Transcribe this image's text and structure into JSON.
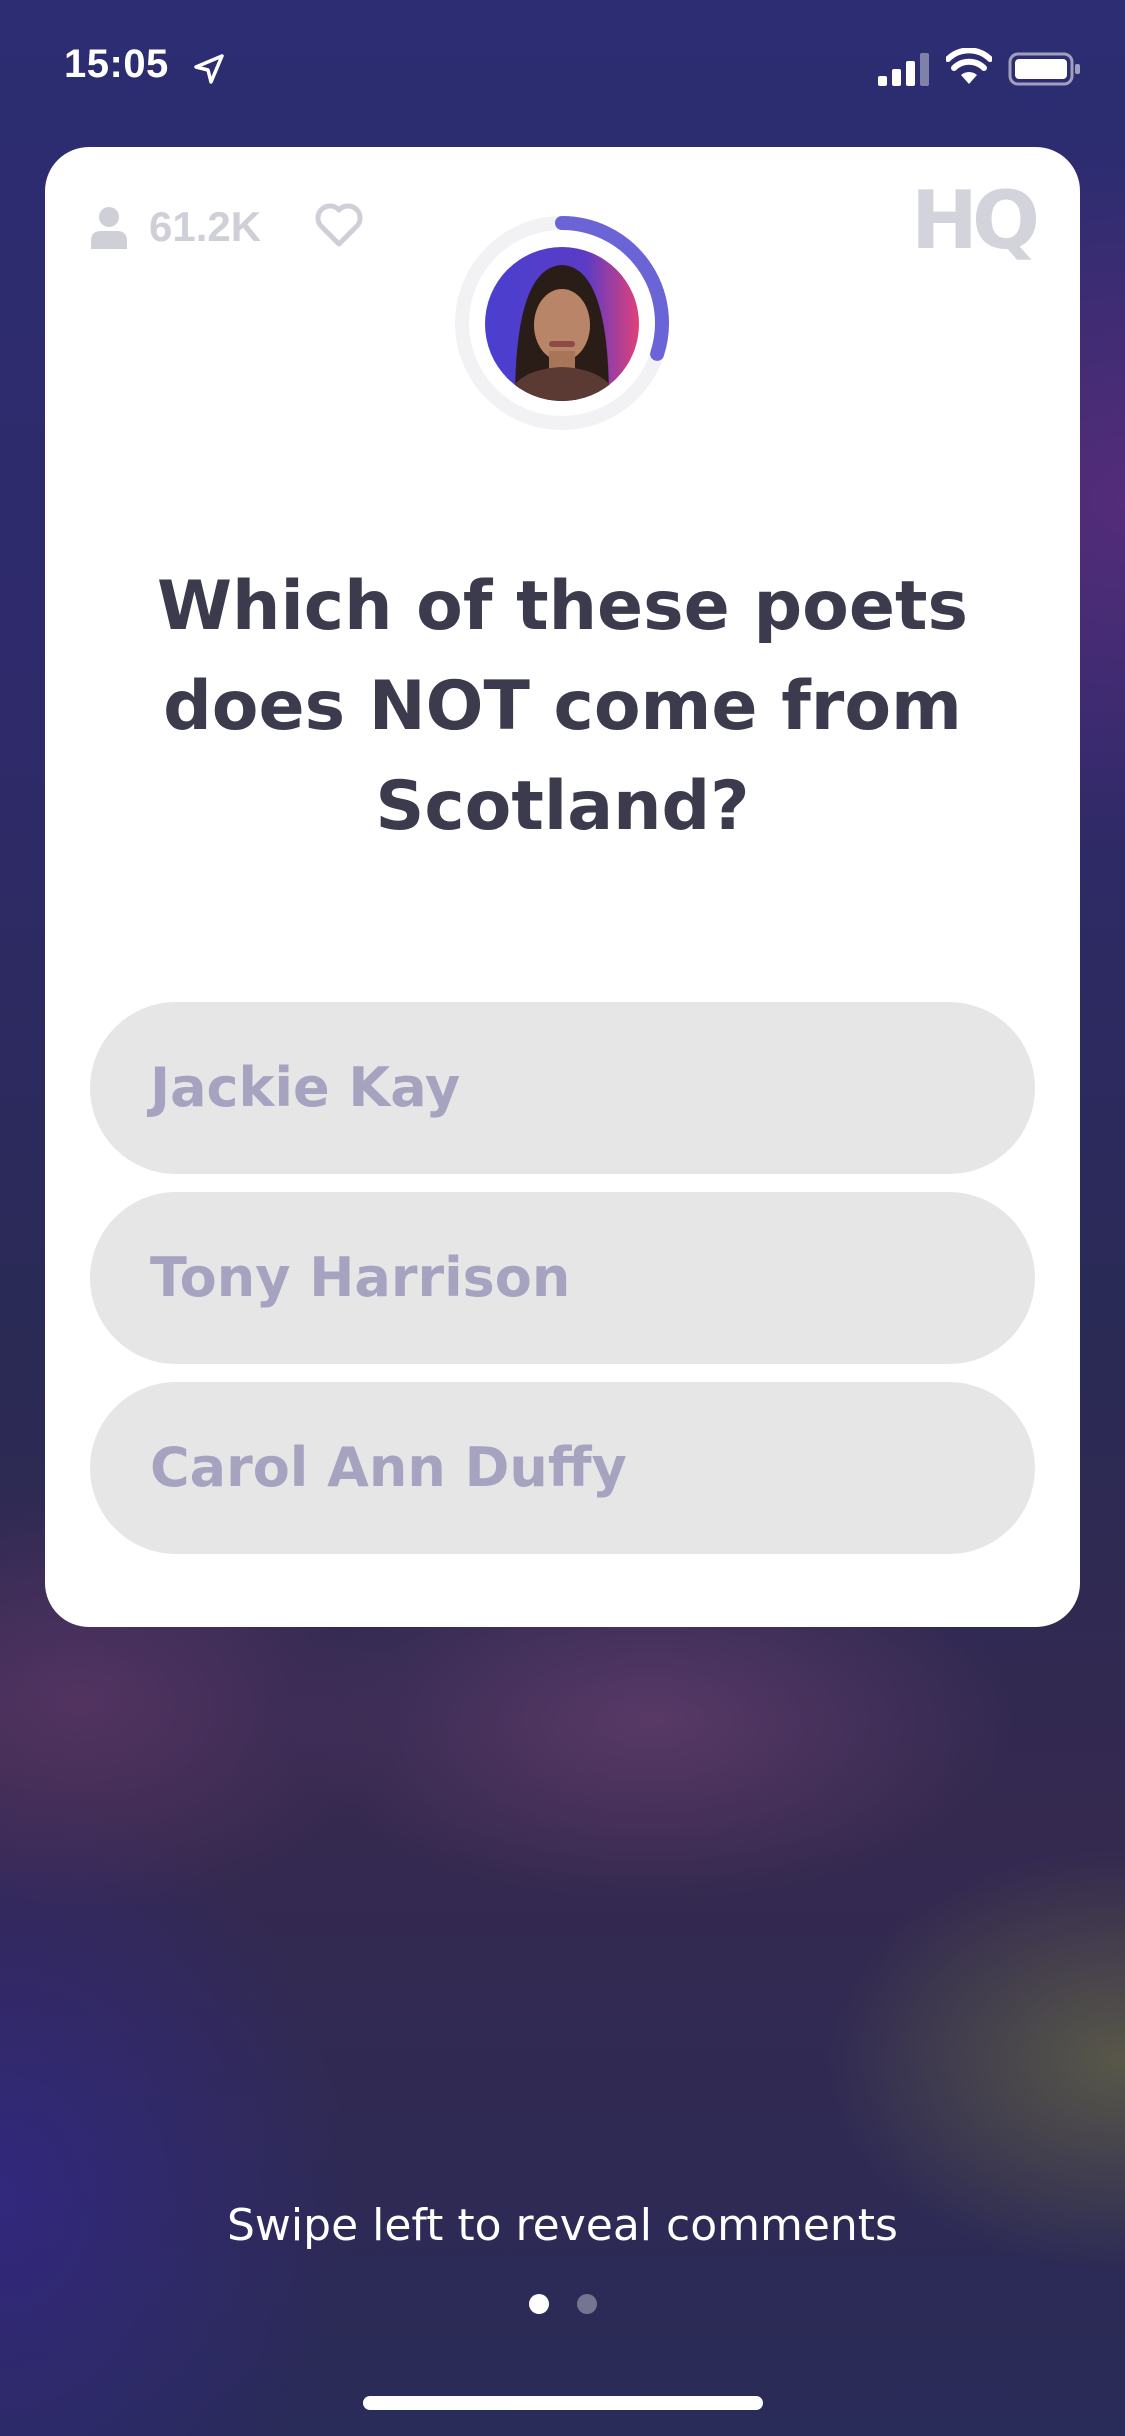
{
  "status_bar": {
    "time": "15:05",
    "icons": [
      "location-arrow-icon",
      "cellular-signal-icon",
      "wifi-icon",
      "battery-icon"
    ]
  },
  "card": {
    "viewer_count": "61.2K",
    "logo_text": "HQ",
    "question": "Which of these poets does NOT come from Scotland?",
    "answers": [
      {
        "label": "Jackie Kay"
      },
      {
        "label": "Tony Harrison"
      },
      {
        "label": "Carol Ann Duffy"
      }
    ],
    "timer_progress": 0.3
  },
  "footer": {
    "swipe_hint": "Swipe left to reveal comments",
    "page_indicator": {
      "pages": 2,
      "current": 1
    }
  },
  "colors": {
    "card_background": "#ffffff",
    "question_text": "#3b3b4d",
    "answer_background": "#e6e6e7",
    "answer_text": "#a6a3c0",
    "timer_arc": "#6b64d6",
    "muted_icon": "#cfcfd8"
  }
}
